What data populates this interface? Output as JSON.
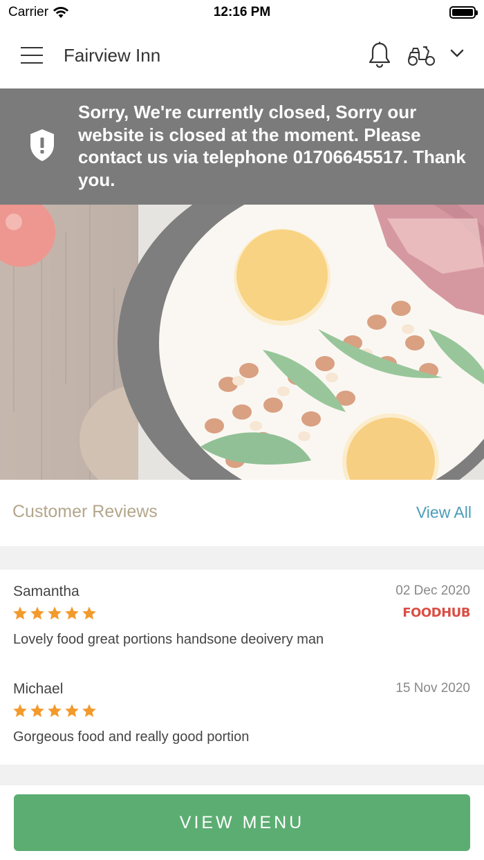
{
  "status_bar": {
    "carrier": "Carrier",
    "time": "12:16 PM"
  },
  "header": {
    "title": "Fairview Inn"
  },
  "closed_banner": {
    "message": "Sorry, We're currently closed, Sorry our website is closed at the moment. Please contact us via telephone 01706645517. Thank you."
  },
  "reviews": {
    "title": "Customer Reviews",
    "view_all": "View All",
    "items": [
      {
        "name": "Samantha",
        "date": "02 Dec 2020",
        "rating": 5,
        "text": "Lovely food great portions handsone deoivery man",
        "source": "FOODHUB"
      },
      {
        "name": "Michael",
        "date": "15 Nov 2020",
        "rating": 5,
        "text": "Gorgeous food and really good portion"
      }
    ]
  },
  "footer": {
    "view_menu": "VIEW MENU"
  },
  "colors": {
    "accent_green": "#5cad72",
    "link_blue": "#4a9db8",
    "star_orange": "#f39a2c",
    "banner_gray": "#7b7b7b"
  }
}
